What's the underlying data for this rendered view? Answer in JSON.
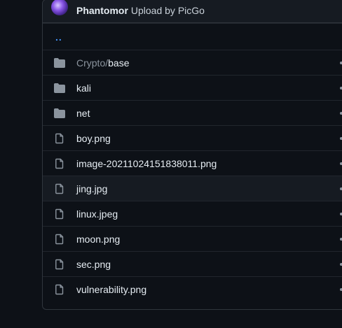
{
  "commit": {
    "author": "Phantomor",
    "message": "Upload by PicGo"
  },
  "parent_link": "..",
  "files": [
    {
      "type": "dir",
      "prefix": "Crypto/",
      "name": "base"
    },
    {
      "type": "dir",
      "prefix": "",
      "name": "kali"
    },
    {
      "type": "dir",
      "prefix": "",
      "name": "net"
    },
    {
      "type": "file",
      "prefix": "",
      "name": "boy.png"
    },
    {
      "type": "file",
      "prefix": "",
      "name": "image-20211024151838011.png"
    },
    {
      "type": "file",
      "prefix": "",
      "name": "jing.jpg"
    },
    {
      "type": "file",
      "prefix": "",
      "name": "linux.jpeg"
    },
    {
      "type": "file",
      "prefix": "",
      "name": "moon.png"
    },
    {
      "type": "file",
      "prefix": "",
      "name": "sec.png"
    },
    {
      "type": "file",
      "prefix": "",
      "name": "vulnerability.png"
    }
  ],
  "icons": {
    "dir": "folder-icon",
    "file": "file-icon"
  },
  "colors": {
    "background": "#0d1117",
    "header": "#161b22",
    "border": "#30363d",
    "link": "#4493f8",
    "icon": "#8b949e"
  }
}
